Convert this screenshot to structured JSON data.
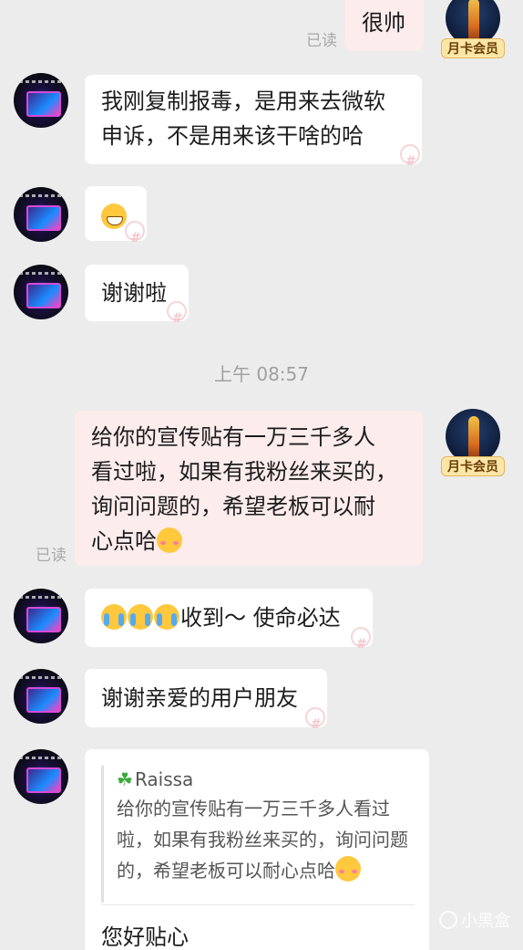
{
  "messages": {
    "m1": {
      "text": "很帅",
      "read": "已读"
    },
    "m2": {
      "line1": "我刚复制报毒，是用来去微软",
      "line2": "申诉，不是用来该干啥的哈"
    },
    "m3": {
      "emoji": "grinning-face"
    },
    "m4": {
      "text": "谢谢啦"
    },
    "timestamp": "上午 08:57",
    "m5": {
      "line1": "给你的宣传贴有一万三千多人",
      "line2": "看过啦，如果有我粉丝来买的，",
      "line3": "询问问题的，希望老板可以耐",
      "line4": "心点哈",
      "emoji": "shy-face",
      "read": "已读"
    },
    "m6": {
      "text": "收到～ 使命必达",
      "emojis": [
        "crying-face",
        "crying-face",
        "crying-face"
      ]
    },
    "m7": {
      "text": "谢谢亲爱的用户朋友"
    },
    "m8": {
      "quote_author": "Raissa",
      "quote_line1": "给你的宣传贴有一万三千多人看过",
      "quote_line2": "啦，如果有我粉丝来买的，询问问题",
      "quote_line3": "的，希望老板可以耐心点哈",
      "reply": "您好贴心"
    }
  },
  "self": {
    "badge": "月卡会员"
  },
  "site_watermark": "小黑盒",
  "colors": {
    "background": "#ececec",
    "bubble_self": "#fdecec",
    "bubble_other": "#ffffff",
    "badge_bg": "#fbe6a8"
  }
}
